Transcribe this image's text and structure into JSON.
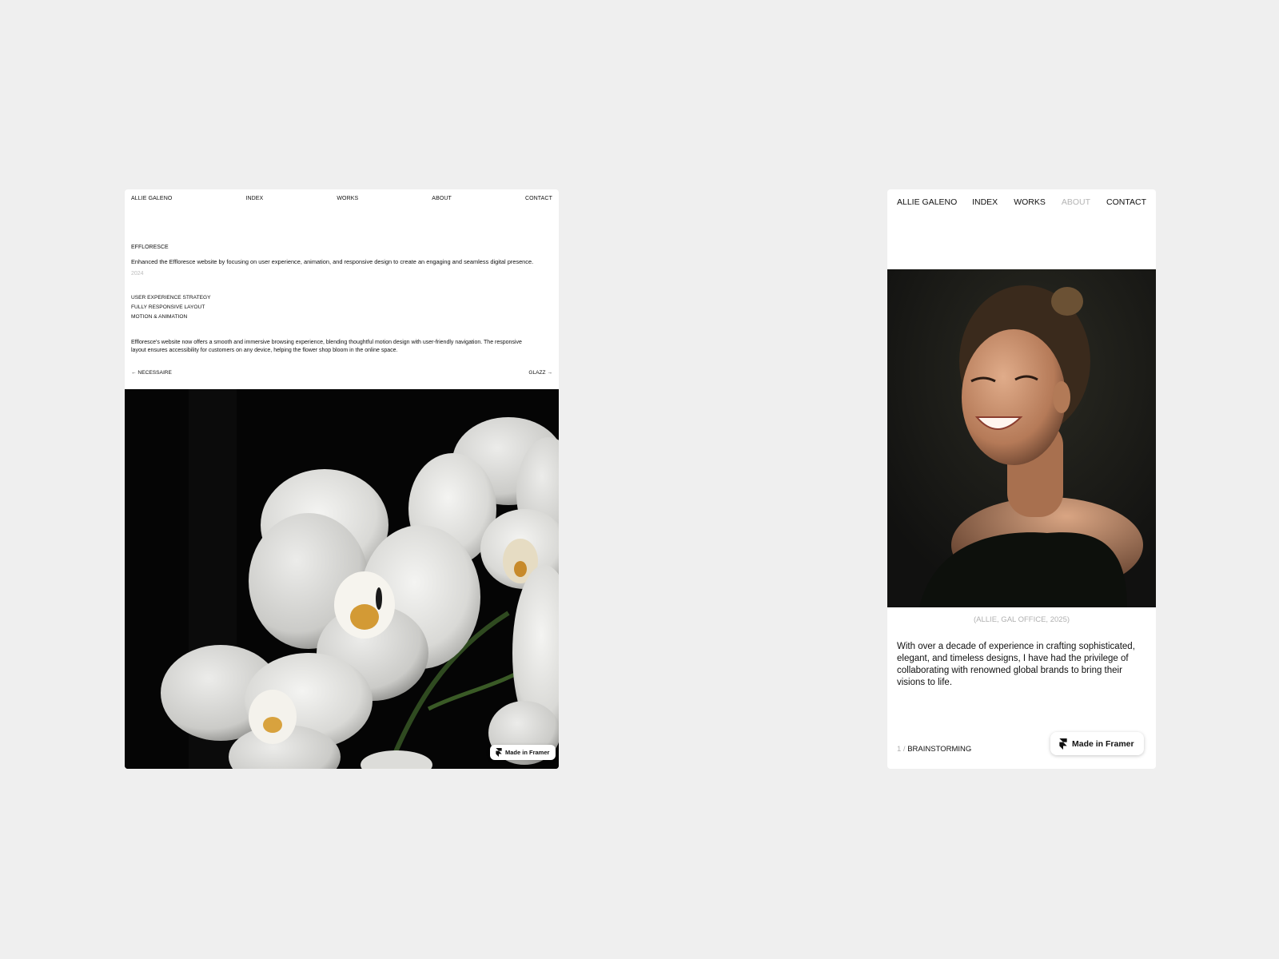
{
  "desktop_page": {
    "nav": {
      "brand": "ALLIE GALENO",
      "index": "INDEX",
      "works": "WORKS",
      "about": "ABOUT",
      "contact": "CONTACT"
    },
    "project": {
      "title": "EFFLORESCE",
      "description": "Enhanced the Efflorescе website by focusing on user experience, animation, and responsive design to create an engaging and seamless digital presence.",
      "year": "2024",
      "services": [
        "USER EXPERIENCE STRATEGY",
        "FULLY RESPONSIVE LAYOUT",
        "MOTION & ANIMATION"
      ],
      "body": "Efflorescе's website now offers a smooth and immersive browsing experience, blending thoughtful motion design with user-friendly navigation. The responsive layout ensures accessibility for customers on any device, helping the flower shop bloom in the online space."
    },
    "pager": {
      "prev": "← NECESSAIRE",
      "next": "GLAZZ →"
    },
    "badge": "Made in Framer"
  },
  "mobile_page": {
    "nav": {
      "brand": "ALLIE GALENO",
      "index": "INDEX",
      "works": "WORKS",
      "about": "ABOUT",
      "contact": "CONTACT"
    },
    "caption": "(ALLIE, GAL OFFICE, 2025)",
    "bio": "With over a decade of experience in crafting sophisticated, elegant, and timeless designs, I have had the privilege of collaborating with renowned global brands to bring their visions to life.",
    "footer": {
      "index_number": "1 /",
      "index_label": "BRAINSTORMING"
    },
    "badge": "Made in Framer"
  },
  "colors": {
    "page_background": "#efefef",
    "card_background": "#ffffff",
    "muted_text": "#b5b5b5",
    "photo_background": "#050505"
  }
}
